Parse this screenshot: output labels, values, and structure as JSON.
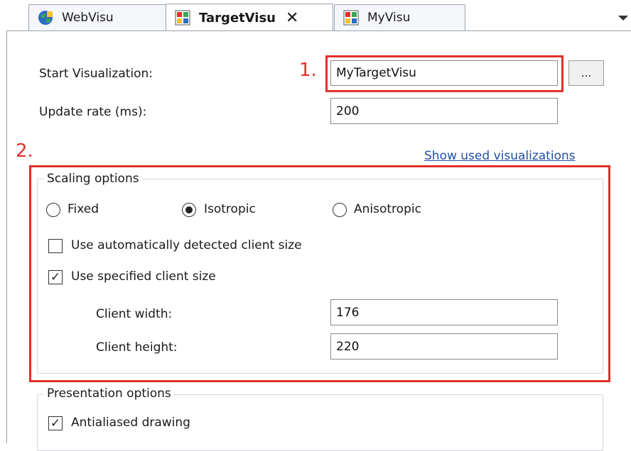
{
  "tabs": [
    {
      "label": "WebVisu",
      "active": false
    },
    {
      "label": "TargetVisu",
      "active": true
    },
    {
      "label": "MyVisu",
      "active": false
    }
  ],
  "tab_close_glyph": "✕",
  "settings": {
    "start_visualization_label": "Start Visualization:",
    "start_visualization_value": "MyTargetVisu",
    "browse_label": "...",
    "update_rate_label": "Update rate (ms):",
    "update_rate_value": "200",
    "show_used_link": "Show used visualizations"
  },
  "annotations": {
    "step1": "1.",
    "step2": "2."
  },
  "scaling": {
    "title": "Scaling options",
    "radio_fixed": "Fixed",
    "radio_isotropic": "Isotropic",
    "radio_anisotropic": "Anisotropic",
    "selected": "Isotropic",
    "auto_detect_label": "Use automatically detected client size",
    "auto_detect_checked": false,
    "specified_label": "Use specified client size",
    "specified_checked": true,
    "client_width_label": "Client width:",
    "client_width_value": "176",
    "client_height_label": "Client height:",
    "client_height_value": "220"
  },
  "presentation": {
    "title": "Presentation options",
    "antialiased_label": "Antialiased drawing",
    "antialiased_checked": true
  },
  "colors": {
    "highlight": "#e0302a",
    "link": "#1f4fa3",
    "border": "#9aa3ae"
  }
}
